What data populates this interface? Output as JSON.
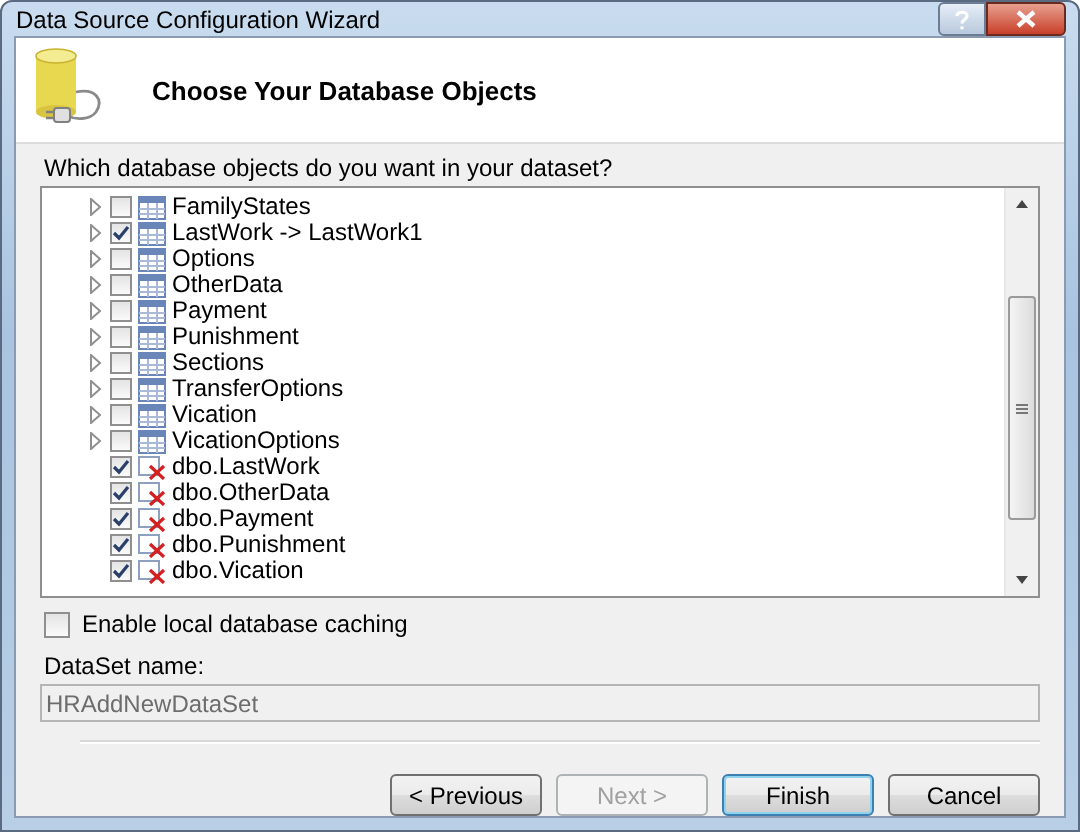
{
  "window": {
    "title": "Data Source Configuration Wizard"
  },
  "header": {
    "title": "Choose Your Database Objects"
  },
  "prompt": "Which database objects do you want in your dataset?",
  "tree": [
    {
      "label": "FamilyStates",
      "kind": "table",
      "checked": false,
      "expanded": false
    },
    {
      "label": "LastWork -> LastWork1",
      "kind": "table",
      "checked": true,
      "expanded": false
    },
    {
      "label": "Options",
      "kind": "table",
      "checked": false,
      "expanded": false
    },
    {
      "label": "OtherData",
      "kind": "table",
      "checked": false,
      "expanded": false
    },
    {
      "label": "Payment",
      "kind": "table",
      "checked": false,
      "expanded": false
    },
    {
      "label": "Punishment",
      "kind": "table",
      "checked": false,
      "expanded": false
    },
    {
      "label": "Sections",
      "kind": "table",
      "checked": false,
      "expanded": false
    },
    {
      "label": "TransferOptions",
      "kind": "table",
      "checked": false,
      "expanded": false
    },
    {
      "label": "Vication",
      "kind": "table",
      "checked": false,
      "expanded": false
    },
    {
      "label": "VicationOptions",
      "kind": "table",
      "checked": false,
      "expanded": false
    },
    {
      "label": "dbo.LastWork",
      "kind": "missing",
      "checked": true
    },
    {
      "label": "dbo.OtherData",
      "kind": "missing",
      "checked": true
    },
    {
      "label": "dbo.Payment",
      "kind": "missing",
      "checked": true
    },
    {
      "label": "dbo.Punishment",
      "kind": "missing",
      "checked": true
    },
    {
      "label": "dbo.Vication",
      "kind": "missing",
      "checked": true
    }
  ],
  "caching": {
    "label": "Enable local database caching",
    "checked": false
  },
  "dataset": {
    "label": "DataSet name:",
    "value": "HRAddNewDataSet",
    "disabled": true
  },
  "buttons": [
    {
      "label": "< Previous",
      "disabled": false,
      "default": false
    },
    {
      "label": "Next >",
      "disabled": true,
      "default": false
    },
    {
      "label": "Finish",
      "disabled": false,
      "default": true
    },
    {
      "label": "Cancel",
      "disabled": false,
      "default": false
    }
  ]
}
